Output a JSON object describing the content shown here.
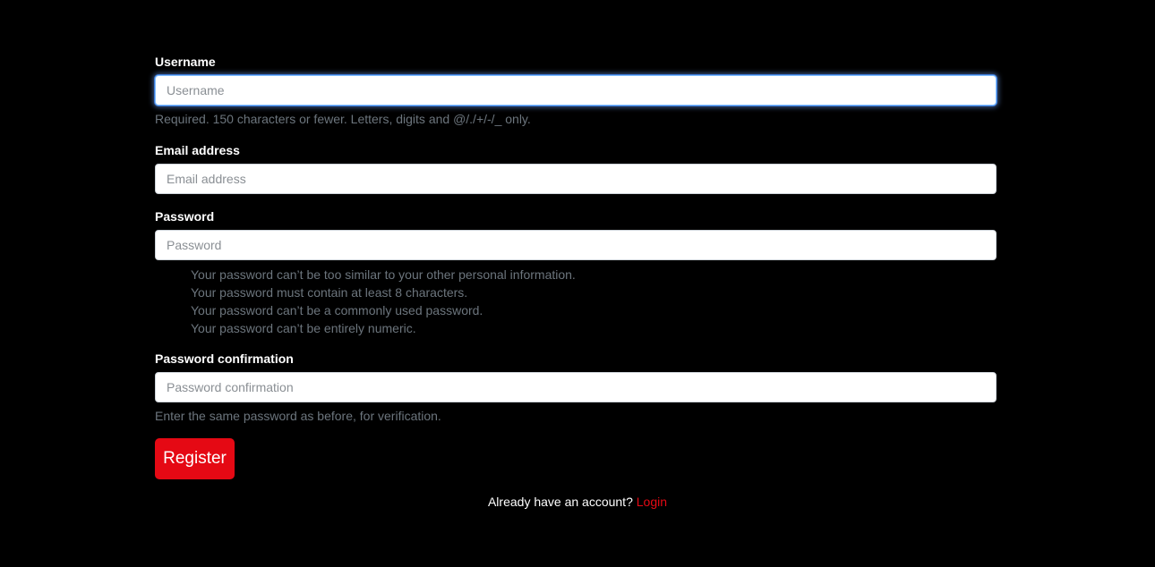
{
  "form": {
    "username": {
      "label": "Username",
      "placeholder": "Username",
      "help": "Required. 150 characters or fewer. Letters, digits and @/./+/-/_ only."
    },
    "email": {
      "label": "Email address",
      "placeholder": "Email address"
    },
    "password": {
      "label": "Password",
      "placeholder": "Password",
      "rules": [
        "Your password can’t be too similar to your other personal information.",
        "Your password must contain at least 8 characters.",
        "Your password can’t be a commonly used password.",
        "Your password can’t be entirely numeric."
      ]
    },
    "password_confirmation": {
      "label": "Password confirmation",
      "placeholder": "Password confirmation",
      "help": "Enter the same password as before, for verification."
    },
    "submit_label": "Register"
  },
  "footer": {
    "prompt": "Already have an account?",
    "link_label": "Login"
  },
  "colors": {
    "background": "#000000",
    "accent": "#e50914",
    "help_text": "#6c757d"
  }
}
